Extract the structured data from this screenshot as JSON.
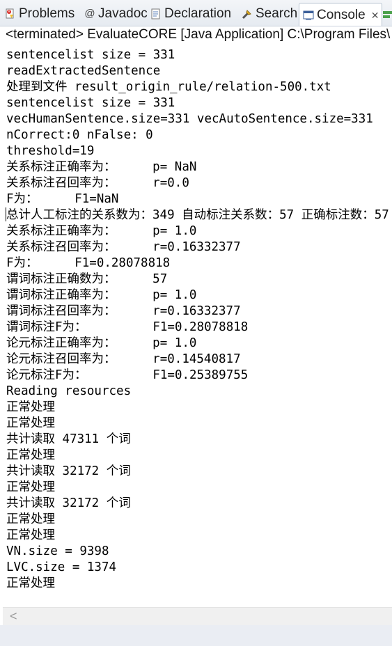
{
  "tabs": [
    {
      "label": "Problems",
      "icon": "problems-icon"
    },
    {
      "label": "Javadoc",
      "icon": "at-sign-icon"
    },
    {
      "label": "Declaration",
      "icon": "declaration-icon"
    },
    {
      "label": "Search",
      "icon": "flashlight-icon"
    },
    {
      "label": "Console",
      "icon": "console-icon",
      "active": true,
      "close": "✕"
    }
  ],
  "title": "<terminated> EvaluateCORE [Java Application] C:\\Program Files\\",
  "lines": [
    "sentencelist size = 331",
    "readExtractedSentence",
    "处理到文件 result_origin_rule/relation-500.txt",
    "sentencelist size = 331",
    "vecHumanSentence.size=331 vecAutoSentence.size=331",
    "nCorrect:0 nFalse: 0",
    "threshold=19",
    "关系标注正确率为：     p= NaN",
    "关系标注召回率为：     r=0.0",
    "F为：     F1=NaN",
    "总计人工标注的关系数为：349 自动标注关系数：57 正确标注数：57",
    "关系标注正确率为：     p= 1.0",
    "关系标注召回率为：     r=0.16332377",
    "F为：     F1=0.28078818",
    "谓词标注正确数为：     57",
    "谓词标注正确率为：     p= 1.0",
    "谓词标注召回率为：     r=0.16332377",
    "谓词标注F为：         F1=0.28078818",
    "论元标注正确率为：     p= 1.0",
    "论元标注召回率为：     r=0.14540817",
    "论元标注F为：         F1=0.25389755",
    "Reading resources",
    "正常处理",
    "正常处理",
    "共计读取 47311 个词",
    "正常处理",
    "共计读取 32172 个词",
    "正常处理",
    "共计读取 32172 个词",
    "正常处理",
    "正常处理",
    "VN.size = 9398",
    "LVC.size = 1374",
    "正常处理"
  ],
  "colors": {
    "tabbar_bg": "#e6ebf1",
    "console_bg": "#ffffff",
    "scroll_bg": "#f0f0f0",
    "bottom_bg": "#eaedf3"
  }
}
